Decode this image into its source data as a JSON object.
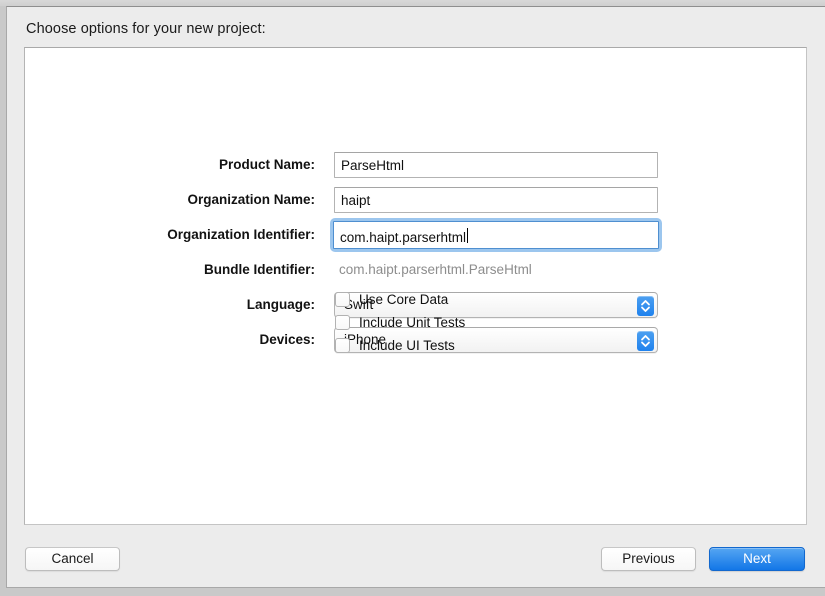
{
  "dialog": {
    "title": "Choose options for your new project:"
  },
  "form": {
    "rows": [
      {
        "label": "Product Name:",
        "value": "ParseHtml",
        "type": "text",
        "focused": false
      },
      {
        "label": "Organization Name:",
        "value": "haipt",
        "type": "text",
        "focused": false
      },
      {
        "label": "Organization Identifier:",
        "value": "com.haipt.parserhtml",
        "type": "text",
        "focused": true
      },
      {
        "label": "Bundle Identifier:",
        "value": "com.haipt.parserhtml.ParseHtml",
        "type": "static",
        "focused": false
      },
      {
        "label": "Language:",
        "value": "Swift",
        "type": "popup",
        "focused": false
      },
      {
        "label": "Devices:",
        "value": "iPhone",
        "type": "popup",
        "focused": false
      }
    ]
  },
  "checkboxes": [
    {
      "label": "Use Core Data",
      "checked": false
    },
    {
      "label": "Include Unit Tests",
      "checked": false
    },
    {
      "label": "Include UI Tests",
      "checked": false
    }
  ],
  "footer": {
    "cancel_label": "Cancel",
    "previous_label": "Previous",
    "next_label": "Next"
  },
  "colors": {
    "accent_blue": "#1276e7",
    "focus_ring": "#9cc6ee",
    "window_background": "#ececec",
    "panel_background": "#ffffff",
    "disabled_text": "#8d8d8d"
  },
  "icons": {
    "stepper": "chevron-up-down-icon"
  }
}
